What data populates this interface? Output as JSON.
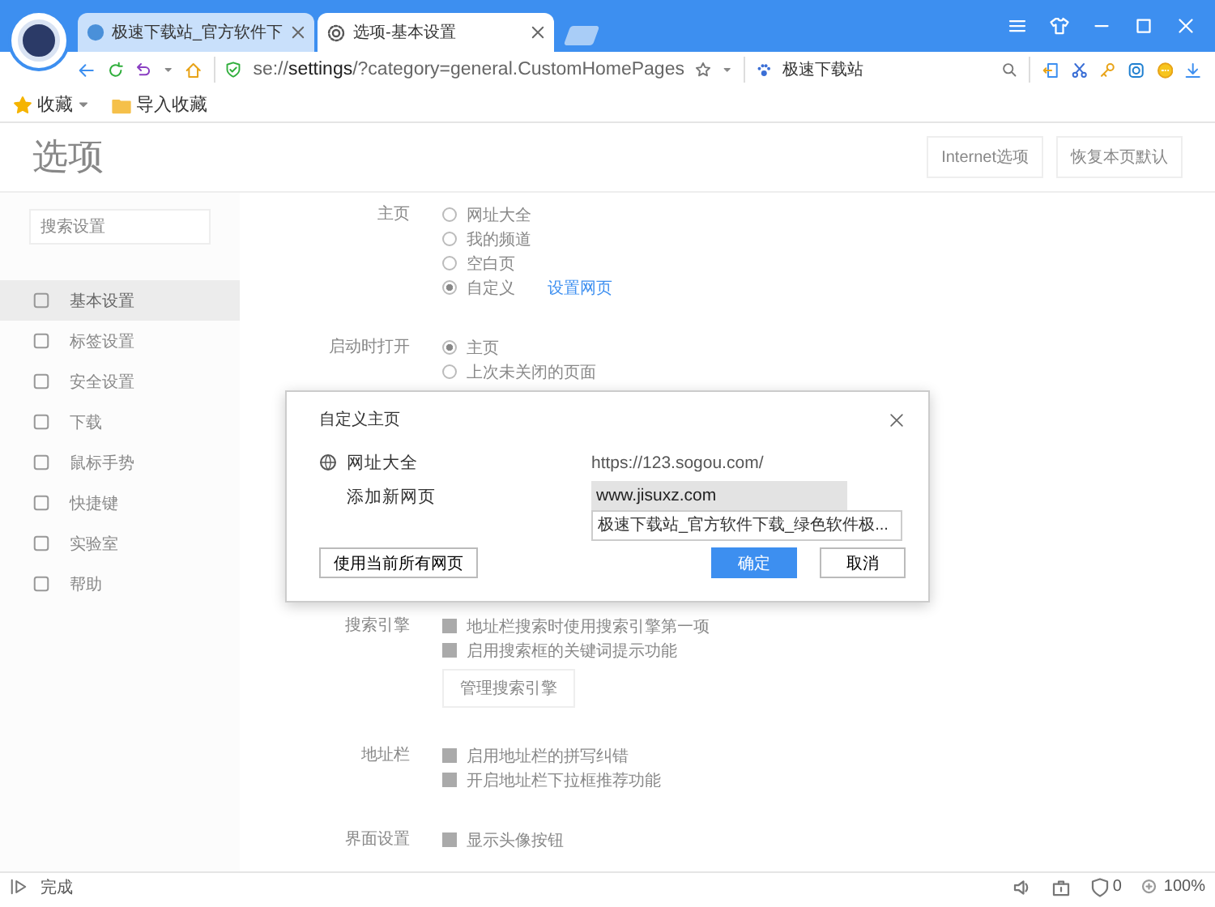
{
  "tabs": [
    {
      "title": "极速下载站_官方软件下",
      "selected": false
    },
    {
      "title": "选项-基本设置",
      "selected": true
    }
  ],
  "toolbar": {
    "address": "se://**settings**/?category=general.CustomHomePages",
    "search": "极速下载站"
  },
  "bookmarks": [
    {
      "label": "收藏",
      "kind": "star"
    },
    {
      "label": "导入收藏",
      "kind": "folder"
    }
  ],
  "settings": {
    "title": "选项",
    "buttons": [
      "Internet选项",
      "恢复本页默认"
    ],
    "search_placeholder": "搜索设置",
    "sidebar": [
      {
        "label": "基本设置",
        "selected": true
      },
      {
        "label": "标签设置",
        "selected": false
      },
      {
        "label": "安全设置",
        "selected": false
      },
      {
        "label": "下载",
        "selected": false
      },
      {
        "label": "鼠标手势",
        "selected": false
      },
      {
        "label": "快捷键",
        "selected": false
      },
      {
        "label": "实验室",
        "selected": false
      },
      {
        "label": "帮助",
        "selected": false
      }
    ],
    "sections": [
      {
        "label": "主页",
        "items": [
          {
            "kind": "radio",
            "text": "网址大全",
            "selected": false
          },
          {
            "kind": "radio",
            "text": "我的频道",
            "selected": false
          },
          {
            "kind": "radio",
            "text": "空白页",
            "selected": false
          },
          {
            "kind": "radio",
            "text": "自定义",
            "selected": true,
            "link": "设置网页"
          }
        ]
      },
      {
        "label": "启动时打开",
        "items": [
          {
            "kind": "radio",
            "text": "主页",
            "selected": true
          },
          {
            "kind": "radio",
            "text": "上次未关闭的页面",
            "selected": false
          }
        ]
      },
      {
        "label": "搜索引擎",
        "items": [
          {
            "kind": "check",
            "text": "地址栏搜索时使用搜索引擎第一项",
            "checked": true
          },
          {
            "kind": "check",
            "text": "启用搜索框的关键词提示功能",
            "checked": true
          },
          {
            "kind": "button",
            "text": "管理搜索引擎"
          }
        ]
      },
      {
        "label": "地址栏",
        "items": [
          {
            "kind": "check",
            "text": "启用地址栏的拼写纠错",
            "checked": true
          },
          {
            "kind": "check",
            "text": "开启地址栏下拉框推荐功能",
            "checked": true
          }
        ]
      },
      {
        "label": "界面设置",
        "items": [
          {
            "kind": "check",
            "text": "显示头像按钮",
            "checked": true
          }
        ]
      }
    ]
  },
  "dialog": {
    "title": "自定义主页",
    "rows": [
      {
        "kind": "site",
        "name": "网址大全",
        "url": "https://123.sogou.com/"
      },
      {
        "kind": "input",
        "name": "添加新网页",
        "value": "www.jisuxz.com",
        "suggestion": "极速下载站_官方软件下载_绿色软件极..."
      }
    ],
    "left_button": "使用当前所有网页",
    "ok": "确定",
    "cancel": "取消"
  },
  "status_bar": {
    "text": "完成",
    "blocked": "0",
    "zoom": "100%"
  }
}
